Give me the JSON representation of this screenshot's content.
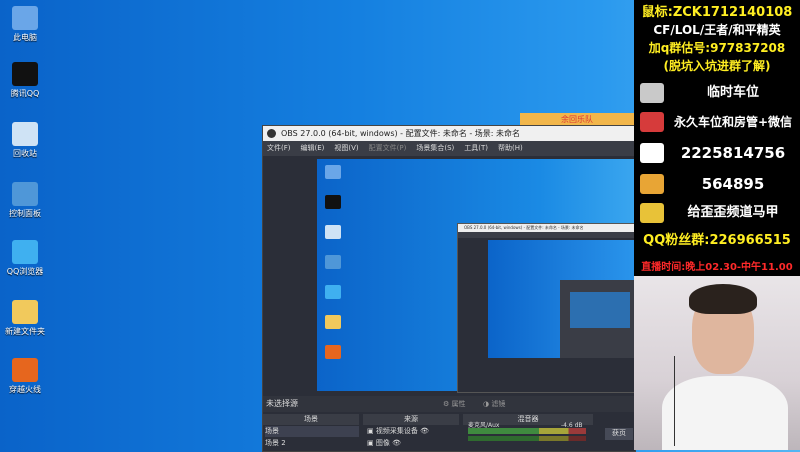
{
  "desktop": {
    "icons": [
      {
        "label": "此电脑",
        "icon": "computer-icon",
        "color": "#6aa6e8"
      },
      {
        "label": "腾讯QQ",
        "icon": "qq-penguin-icon",
        "color": "#111111"
      },
      {
        "label": "回收站",
        "icon": "recycle-bin-icon",
        "color": "#cfe3f5"
      },
      {
        "label": "控制面板",
        "icon": "control-panel-icon",
        "color": "#4f97d8"
      },
      {
        "label": "QQ浏览器",
        "icon": "qq-browser-icon",
        "color": "#3fb0f0"
      },
      {
        "label": "新建文件夹",
        "icon": "folder-icon",
        "color": "#f1c95c"
      },
      {
        "label": "穿越火线",
        "icon": "crossfire-icon",
        "color": "#e6661e"
      }
    ],
    "background_banner": "余回乐队"
  },
  "obs": {
    "title": "OBS 27.0.0 (64-bit, windows) - 配置文件: 未命名 - 场景: 未命名",
    "menu": [
      {
        "label": "文件(F)",
        "enabled": true
      },
      {
        "label": "编辑(E)",
        "enabled": true
      },
      {
        "label": "视图(V)",
        "enabled": true
      },
      {
        "label": "配置文件(P)",
        "enabled": false
      },
      {
        "label": "场景集合(S)",
        "enabled": true
      },
      {
        "label": "工具(T)",
        "enabled": true
      },
      {
        "label": "帮助(H)",
        "enabled": true
      }
    ],
    "nested_title": "OBS 27.0.0 (64-bit, windows) - 配置文件: 未命名 - 场景: 未命名",
    "status": {
      "no_source": "未选择源",
      "properties": "属性",
      "filters": "滤镜"
    },
    "docks": {
      "scenes_header": "场景",
      "sources_header": "来源",
      "mixer_header": "混音器",
      "scenes": [
        "场景",
        "场景 2"
      ],
      "sources": [
        "视频采集设备",
        "图像"
      ],
      "mixer_channel": "麦克风/Aux",
      "mixer_level": "-4.6 dB",
      "right_button": "获页"
    }
  },
  "overlay": {
    "mouse_tag": "鼠标:ZCK1712140108",
    "games": "CF/LOL/王者/和平精英",
    "group_line": "加q群估号:977837208",
    "group_note": "(脱坑入坑进群了解)",
    "rows": [
      {
        "text": "临时车位",
        "icon": "jet-icon",
        "color": "#c9c9c9"
      },
      {
        "text": "永久车位和房管+微信",
        "icon": "rocket-icon",
        "color": "#d63b3b"
      },
      {
        "text": "2225814756",
        "icon": "qq-penguin-icon",
        "color": "#ffffff"
      },
      {
        "text": "564895",
        "icon": "cat-icon",
        "color": "#e8a535"
      },
      {
        "text": "给歪歪频道马甲",
        "icon": "gold-bar-icon",
        "color": "#e8c238"
      }
    ],
    "fans_group": "QQ粉丝群:226966515",
    "live_time": "直播时间:晚上02.30-中午11.00",
    "colors": {
      "yellow": "#ffee22",
      "red": "#ff2a2a"
    }
  }
}
